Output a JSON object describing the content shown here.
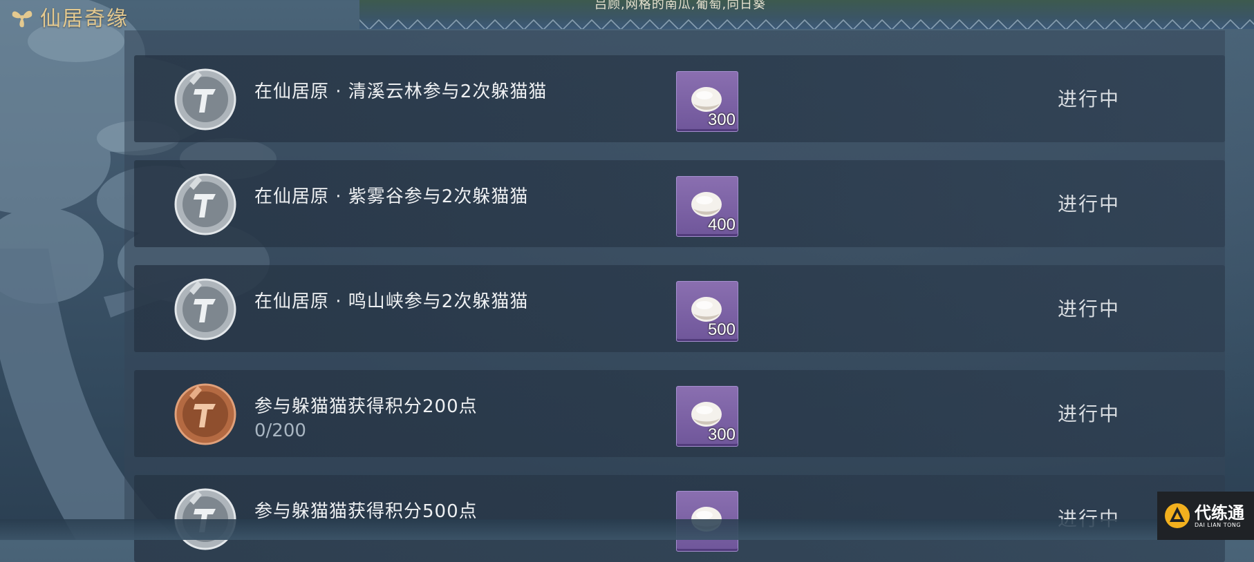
{
  "header": {
    "title": "仙居奇缘",
    "top_hint": "吕顾,网格的南瓜,葡萄,向日葵"
  },
  "tasks": [
    {
      "name": "在仙居原 · 清溪云林参与2次躲猫猫",
      "progress": "",
      "reward_amount": "300",
      "status": "进行中",
      "medal": "silver"
    },
    {
      "name": "在仙居原 · 紫雾谷参与2次躲猫猫",
      "progress": "",
      "reward_amount": "400",
      "status": "进行中",
      "medal": "silver"
    },
    {
      "name": "在仙居原 · 鸣山峡参与2次躲猫猫",
      "progress": "",
      "reward_amount": "500",
      "status": "进行中",
      "medal": "silver"
    },
    {
      "name": "参与躲猫猫获得积分200点",
      "progress": "0/200",
      "reward_amount": "300",
      "status": "进行中",
      "medal": "bronze"
    },
    {
      "name": "参与躲猫猫获得积分500点",
      "progress": "",
      "reward_amount": "",
      "status": "进行中",
      "medal": "silver"
    }
  ],
  "watermark": {
    "name_cn": "代练通",
    "name_en": "DAI LIAN TONG"
  },
  "colors": {
    "title_gold": "#e4c98f",
    "reward_purple": "#7a62a6",
    "silver_medal": "#c9ced3",
    "bronze_medal": "#c07a52"
  }
}
